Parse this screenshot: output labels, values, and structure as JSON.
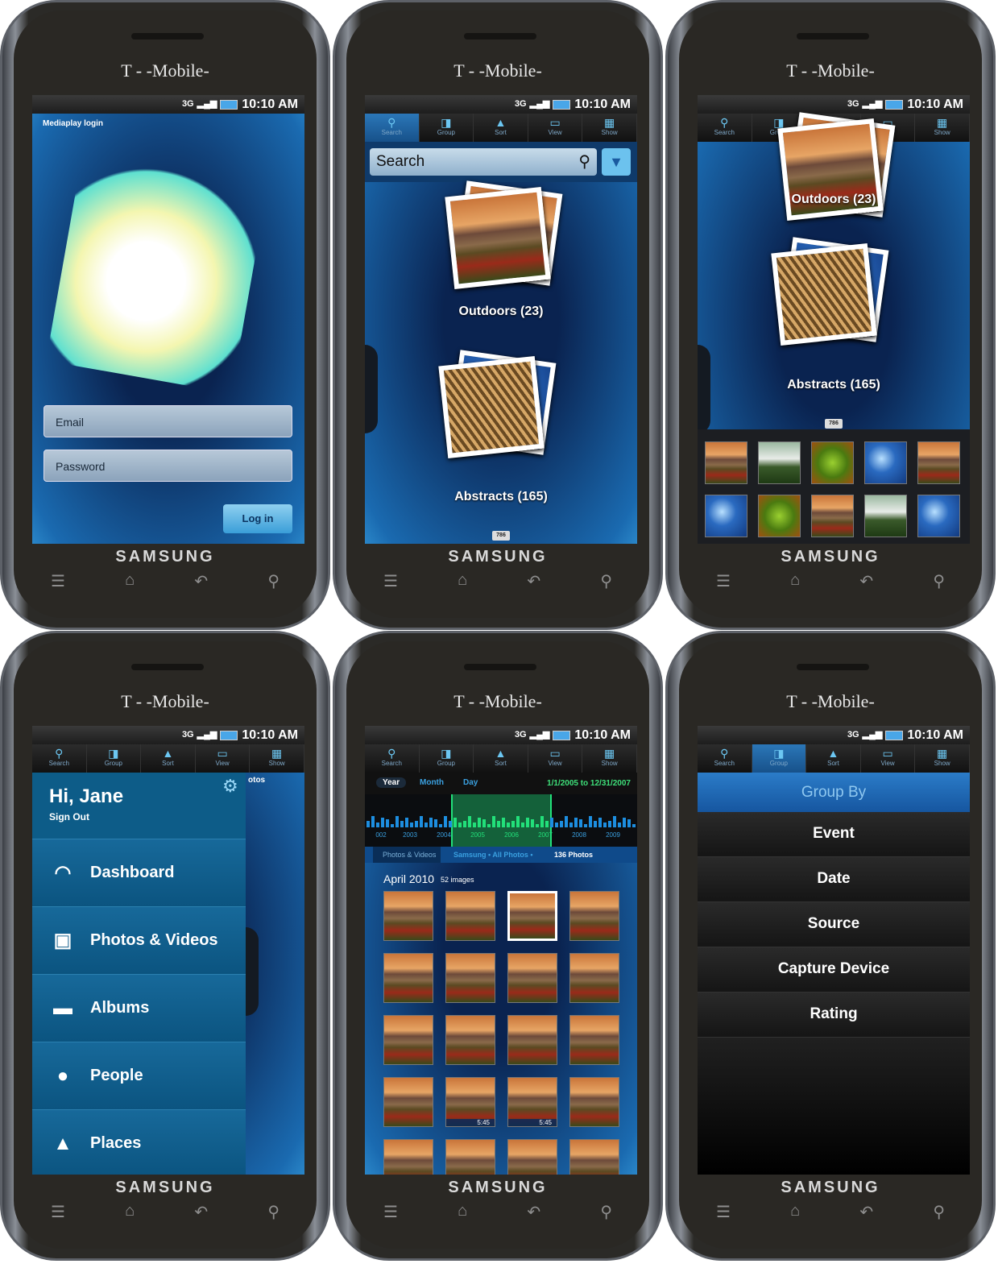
{
  "device": {
    "carrier": "T - -Mobile-",
    "brand": "SAMSUNG",
    "time": "10:10 AM",
    "network": "3G"
  },
  "toolbar": [
    {
      "label": "Search",
      "icon": "search-icon",
      "glyph": "⚲"
    },
    {
      "label": "Group",
      "icon": "group-icon",
      "glyph": "◨"
    },
    {
      "label": "Sort",
      "icon": "sort-icon",
      "glyph": "▲"
    },
    {
      "label": "View",
      "icon": "view-icon",
      "glyph": "▭"
    },
    {
      "label": "Show",
      "icon": "show-grid-icon",
      "glyph": "▦"
    }
  ],
  "hardware_keys": [
    {
      "icon": "menu-icon",
      "glyph": "☰"
    },
    {
      "icon": "home-icon",
      "glyph": "⌂"
    },
    {
      "icon": "back-icon",
      "glyph": "↶"
    },
    {
      "icon": "search-icon",
      "glyph": "⚲"
    }
  ],
  "login": {
    "title": "Mediaplay login",
    "email_placeholder": "Email",
    "password_placeholder": "Password",
    "login_button": "Log in"
  },
  "browse": {
    "search_placeholder": "Search",
    "albums": [
      {
        "name": "Outdoors (23)"
      },
      {
        "name": "Abstracts (165)"
      }
    ],
    "count_badge": "786"
  },
  "menu": {
    "greeting": "Hi, Jane",
    "sign_out": "Sign Out",
    "peek_text": "otos",
    "items": [
      {
        "label": "Dashboard",
        "icon": "dashboard-icon",
        "glyph": "◠"
      },
      {
        "label": "Photos & Videos",
        "icon": "photos-videos-icon",
        "glyph": "▣"
      },
      {
        "label": "Albums",
        "icon": "albums-icon",
        "glyph": "▬"
      },
      {
        "label": "People",
        "icon": "people-icon",
        "glyph": "●"
      },
      {
        "label": "Places",
        "icon": "places-icon",
        "glyph": "▲"
      }
    ]
  },
  "timeline": {
    "tabs": [
      "Year",
      "Month",
      "Day"
    ],
    "active_tab": "Year",
    "range": "1/1/2005 to 12/31/2007",
    "years": [
      "002",
      "2003",
      "2004",
      "2005",
      "2006",
      "2007",
      "2008",
      "2009",
      "20"
    ],
    "back_label": "Photos & Videos",
    "crumbs": "Samsung • All Photos •",
    "count": "136 Photos",
    "section": "April 2010",
    "section_count": "52 images",
    "video_duration": "5:45"
  },
  "group_by": {
    "title": "Group By",
    "options": [
      "Event",
      "Date",
      "Source",
      "Capture Device",
      "Rating"
    ]
  },
  "colors": {
    "accent": "#2a86c8",
    "range_green": "#22e07a"
  }
}
